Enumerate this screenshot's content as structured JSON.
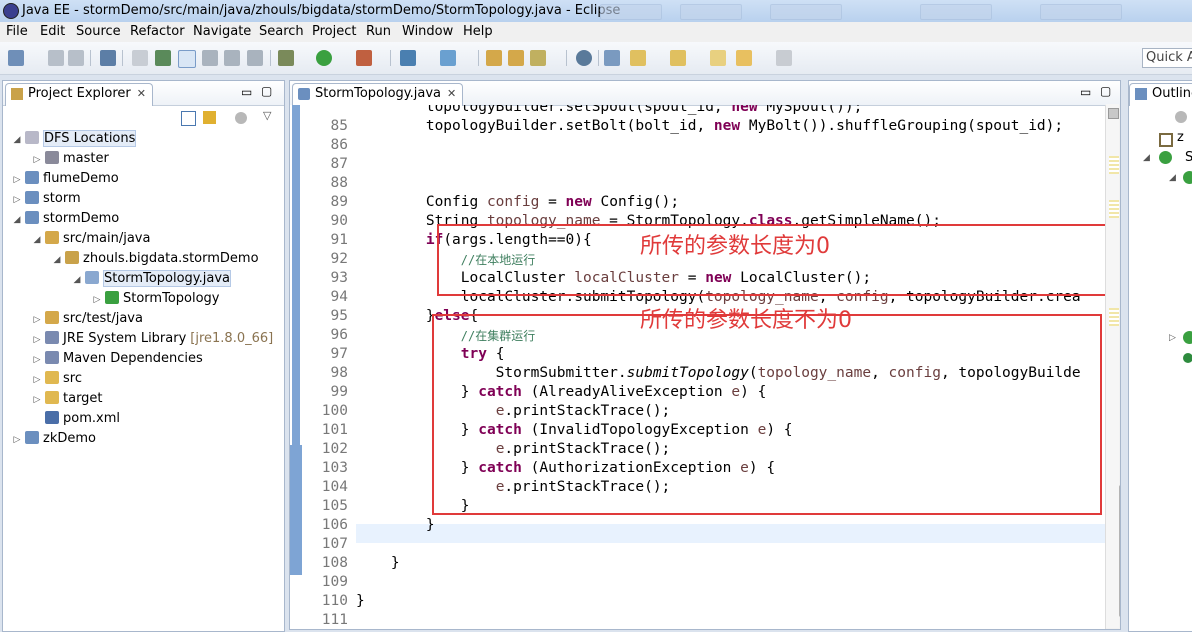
{
  "window": {
    "title": "Java EE - stormDemo/src/main/java/zhouls/bigdata/stormDemo/StormTopology.java - Eclipse"
  },
  "menu": [
    "File",
    "Edit",
    "Source",
    "Refactor",
    "Navigate",
    "Search",
    "Project",
    "Run",
    "Window",
    "Help"
  ],
  "quick_access": "Quick A",
  "project_explorer": {
    "tab_label": "Project Explorer",
    "tab_close": "✕",
    "tree": [
      {
        "label": "DFS Locations",
        "twisty": "◢",
        "icon": "dfs-icon",
        "depth": 1
      },
      {
        "label": "master",
        "twisty": "▷",
        "icon": "elephant-icon",
        "depth": 2
      },
      {
        "label": "flumeDemo",
        "twisty": "▷",
        "icon": "maven-project-icon",
        "depth": 1
      },
      {
        "label": "storm",
        "twisty": "▷",
        "icon": "maven-project-icon",
        "depth": 1
      },
      {
        "label": "stormDemo",
        "twisty": "◢",
        "icon": "maven-project-icon",
        "depth": 1
      },
      {
        "label": "src/main/java",
        "twisty": "◢",
        "icon": "source-folder-icon",
        "depth": 2
      },
      {
        "label": "zhouls.bigdata.stormDemo",
        "twisty": "◢",
        "icon": "package-icon",
        "depth": 3
      },
      {
        "label": "StormTopology.java",
        "twisty": "◢",
        "icon": "java-file-icon",
        "depth": 4
      },
      {
        "label": "StormTopology",
        "twisty": "▷",
        "icon": "class-icon",
        "depth": 5
      },
      {
        "label": "src/test/java",
        "twisty": "▷",
        "icon": "source-folder-icon",
        "depth": 2
      },
      {
        "label": "JRE System Library",
        "sub": "[jre1.8.0_66]",
        "twisty": "▷",
        "icon": "library-icon",
        "depth": 2
      },
      {
        "label": "Maven Dependencies",
        "twisty": "▷",
        "icon": "library-icon",
        "depth": 2
      },
      {
        "label": "src",
        "twisty": "▷",
        "icon": "folder-icon",
        "depth": 2
      },
      {
        "label": "target",
        "twisty": "▷",
        "icon": "folder-icon",
        "depth": 2
      },
      {
        "label": "pom.xml",
        "twisty": "",
        "icon": "pom-icon",
        "depth": 2
      },
      {
        "label": "zkDemo",
        "twisty": "▷",
        "icon": "maven-project-icon",
        "depth": 1
      }
    ]
  },
  "editor": {
    "tab_label": "StormTopology.java",
    "tab_close": "✕",
    "lines": [
      {
        "n": "",
        "html": "        topologyBuilder.setSpout(spout_id, <span class=\"kw\">new</span> MySpout());"
      },
      {
        "n": "85",
        "html": "        topologyBuilder.setBolt(bolt_id, <span class=\"kw\">new</span> MyBolt()).shuffleGrouping(spout_id);"
      },
      {
        "n": "86",
        "html": ""
      },
      {
        "n": "87",
        "html": ""
      },
      {
        "n": "88",
        "html": ""
      },
      {
        "n": "89",
        "html": "        Config <span class=\"lv\">config</span> = <span class=\"kw\">new</span> Config();"
      },
      {
        "n": "90",
        "html": "        String <span class=\"lv\">topology_name</span> = StormTopology.<span class=\"kw\">class</span>.getSimpleName();"
      },
      {
        "n": "91",
        "html": "        <span class=\"kw\">if</span>(args.length==0){"
      },
      {
        "n": "92",
        "html": "            <span class=\"cm\">//在本地运行</span>"
      },
      {
        "n": "93",
        "html": "            LocalCluster <span class=\"lv\">localCluster</span> = <span class=\"kw\">new</span> LocalCluster();"
      },
      {
        "n": "94",
        "html": "            localCluster.submitTopology(<span class=\"lv\">topology_name</span>, <span class=\"lv\">config</span>, topologyBuilder.crea"
      },
      {
        "n": "95",
        "html": "        }<span class=\"kw\">else</span>{"
      },
      {
        "n": "96",
        "html": "            <span class=\"cm\">//在集群运行</span>"
      },
      {
        "n": "97",
        "html": "            <span class=\"kw\">try</span> {"
      },
      {
        "n": "98",
        "html": "                StormSubmitter.<span class=\"it\">submitTopology</span>(<span class=\"lv\">topology_name</span>, <span class=\"lv\">config</span>, topologyBuilde"
      },
      {
        "n": "99",
        "html": "            } <span class=\"kw\">catch</span> (AlreadyAliveException <span class=\"lv\">e</span>) {"
      },
      {
        "n": "100",
        "html": "                <span class=\"lv\">e</span>.printStackTrace();"
      },
      {
        "n": "101",
        "html": "            } <span class=\"kw\">catch</span> (InvalidTopologyException <span class=\"lv\">e</span>) {"
      },
      {
        "n": "102",
        "html": "                <span class=\"lv\">e</span>.printStackTrace();"
      },
      {
        "n": "103",
        "html": "            } <span class=\"kw\">catch</span> (AuthorizationException <span class=\"lv\">e</span>) {"
      },
      {
        "n": "104",
        "html": "                <span class=\"lv\">e</span>.printStackTrace();"
      },
      {
        "n": "105",
        "html": "            }"
      },
      {
        "n": "106",
        "html": "        }"
      },
      {
        "n": "107",
        "html": ""
      },
      {
        "n": "108",
        "html": "    }"
      },
      {
        "n": "109",
        "html": ""
      },
      {
        "n": "110",
        "html": "}"
      },
      {
        "n": "111",
        "html": ""
      }
    ],
    "annotation_local": "所传的参数长度为0",
    "annotation_cluster": "所传的参数长度不为0"
  },
  "outline": {
    "tab_label": "Outline"
  },
  "colors": {
    "annotation": "#e03a3a",
    "keyword": "#7f0055",
    "comment": "#3f7f5f",
    "local_var": "#6a3e3e"
  }
}
